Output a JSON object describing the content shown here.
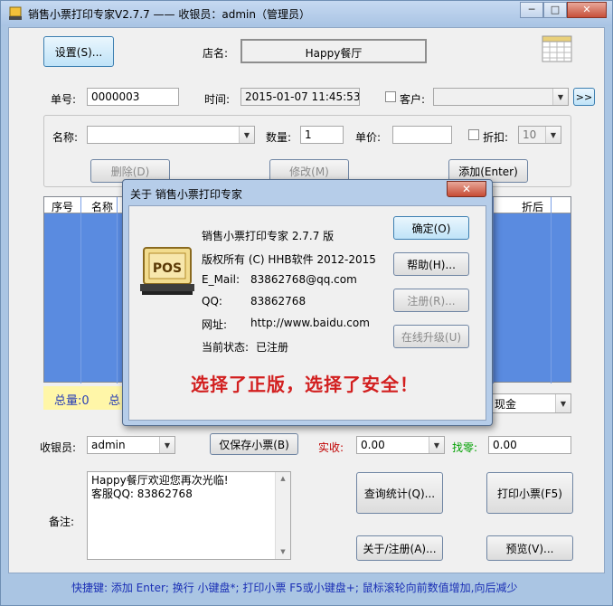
{
  "window": {
    "title": "销售小票打印专家V2.7.7 —— 收银员：admin（管理员）",
    "controls": {
      "minimize": "─",
      "maximize": "□",
      "close": "✕"
    }
  },
  "header": {
    "settings_button": "设置(S)...",
    "store_label": "店名:",
    "store_name": "Happy餐厅"
  },
  "order": {
    "number_label": "单号:",
    "number": "0000003",
    "time_label": "时间:",
    "time": "2015-01-07 11:45:53",
    "customer_label": "客户:",
    "customer_value": "",
    "more_button": ">>"
  },
  "item_entry": {
    "name_label": "名称:",
    "name_value": "",
    "qty_label": "数量:",
    "qty_value": "1",
    "price_label": "单价:",
    "price_value": "",
    "discount_label": "折扣:",
    "discount_value": "10",
    "delete_button": "删除(D)",
    "edit_button": "修改(M)",
    "add_button": "添加(Enter)"
  },
  "grid": {
    "columns": [
      "序号",
      "名称",
      "折后"
    ]
  },
  "summary": {
    "total_qty": "总量:0",
    "total_prefix": "总",
    "payment_method": "现金"
  },
  "payment": {
    "cashier_label": "收银员:",
    "cashier_value": "admin",
    "save_only_button": "仅保存小票(B)",
    "received_label": "实收:",
    "received_value": "0.00",
    "change_label": "找零:",
    "change_value": "0.00"
  },
  "notes": {
    "label": "备注:",
    "line1": "Happy餐厅欢迎您再次光临!",
    "line2": "客服QQ: 83862768"
  },
  "actions": {
    "stats_button": "查询统计(Q)...",
    "print_button": "打印小票(F5)",
    "about_button": "关于/注册(A)...",
    "preview_button": "预览(V)..."
  },
  "footer": {
    "hint": "快捷键: 添加 Enter; 换行 小键盘*; 打印小票 F5或小键盘+; 鼠标滚轮向前数值增加,向后减少"
  },
  "about_dialog": {
    "title": "关于 销售小票打印专家",
    "close": "✕",
    "logo_text": "POS",
    "product": "销售小票打印专家 2.7.7 版",
    "copyright": "版权所有 (C) HHB软件 2012-2015",
    "email_label": "E_Mail:",
    "email": "83862768@qq.com",
    "qq_label": "QQ:",
    "qq": "83862768",
    "site_label": "网址:",
    "site": "http://www.baidu.com",
    "status_label": "当前状态:",
    "status": "已注册",
    "slogan": "选择了正版，选择了安全！",
    "ok_button": "确定(O)",
    "help_button": "帮助(H)...",
    "register_button": "注册(R)...",
    "upgrade_button": "在线升级(U)"
  }
}
